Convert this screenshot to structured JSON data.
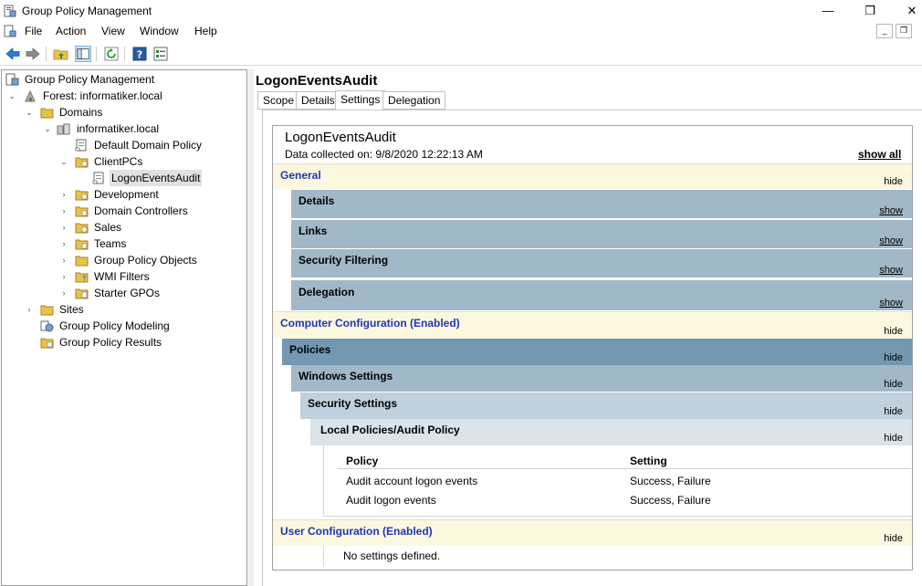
{
  "window": {
    "title": "Group Policy Management",
    "controls": {
      "minimize": "—",
      "maximize": "❐",
      "close": "✕"
    }
  },
  "menu": [
    "File",
    "Action",
    "View",
    "Window",
    "Help"
  ],
  "mdi": {
    "minimize": "_",
    "restore": "❐"
  },
  "tree": {
    "root": "Group Policy Management",
    "forest": "Forest: informatiker.local",
    "domains": "Domains",
    "domain": "informatiker.local",
    "default_policy": "Default Domain Policy",
    "clientpcs": "ClientPCs",
    "logon_audit": "LogonEventsAudit",
    "development": "Development",
    "domain_controllers": "Domain Controllers",
    "sales": "Sales",
    "teams": "Teams",
    "gpo_objects": "Group Policy Objects",
    "wmi_filters": "WMI Filters",
    "starter_gpos": "Starter GPOs",
    "sites": "Sites",
    "modeling": "Group Policy Modeling",
    "results": "Group Policy Results"
  },
  "pane": {
    "title": "LogonEventsAudit",
    "tabs": [
      "Scope",
      "Details",
      "Settings",
      "Delegation"
    ],
    "active_tab": "Settings"
  },
  "report": {
    "title": "LogonEventsAudit",
    "collected": "Data collected on: 9/8/2020 12:22:13 AM",
    "show_all": "show all",
    "general": {
      "label": "General",
      "action": "hide"
    },
    "details": {
      "label": "Details",
      "action": "show"
    },
    "links": {
      "label": "Links",
      "action": "show"
    },
    "security_filtering": {
      "label": "Security Filtering",
      "action": "show"
    },
    "delegation": {
      "label": "Delegation",
      "action": "show"
    },
    "computer_config": {
      "label": "Computer Configuration (Enabled)",
      "action": "hide"
    },
    "policies": {
      "label": "Policies",
      "action": "hide"
    },
    "windows_settings": {
      "label": "Windows Settings",
      "action": "hide"
    },
    "security_settings": {
      "label": "Security Settings",
      "action": "hide"
    },
    "local_policies": {
      "label": "Local Policies/Audit Policy",
      "action": "hide"
    },
    "table": {
      "headers": [
        "Policy",
        "Setting"
      ],
      "rows": [
        [
          "Audit account logon events",
          "Success, Failure"
        ],
        [
          "Audit logon events",
          "Success, Failure"
        ]
      ]
    },
    "user_config": {
      "label": "User Configuration (Enabled)",
      "action": "hide"
    },
    "no_settings": "No settings defined."
  }
}
